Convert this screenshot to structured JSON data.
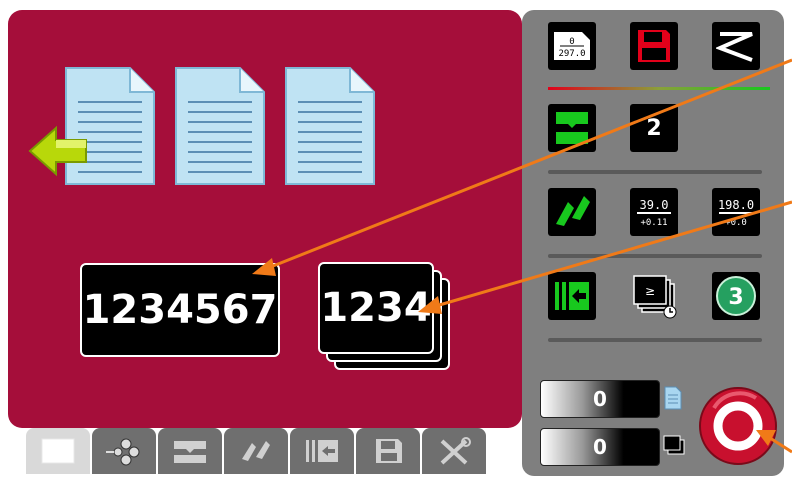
{
  "counters": {
    "total_value": "1234567",
    "sets_value": "1234"
  },
  "buttons": {
    "paper_size_top": "0",
    "paper_size_bottom": "297.0",
    "set_count_value": "2",
    "offset_left_top": "39.0",
    "offset_right_top": "198.0",
    "offset_left_bottom": "+0.11",
    "offset_right_bottom": "+0.0",
    "mode_number": "3",
    "timer_symbol": "≥"
  },
  "status": {
    "sheets_value": "0",
    "sets_value": "0"
  },
  "colors": {
    "panel": "#a50e3a",
    "side": "#7f7f7f",
    "accent": "#f07a18",
    "green": "#18c81e",
    "red": "#e2001a"
  },
  "icons": {
    "document": "document-icon",
    "back": "arrow-left-icon",
    "save": "floppy-disk-icon",
    "zigzag": "zigzag-icon",
    "fold": "fold-icon",
    "offset": "offset-icon",
    "stop": "stop-icon"
  }
}
